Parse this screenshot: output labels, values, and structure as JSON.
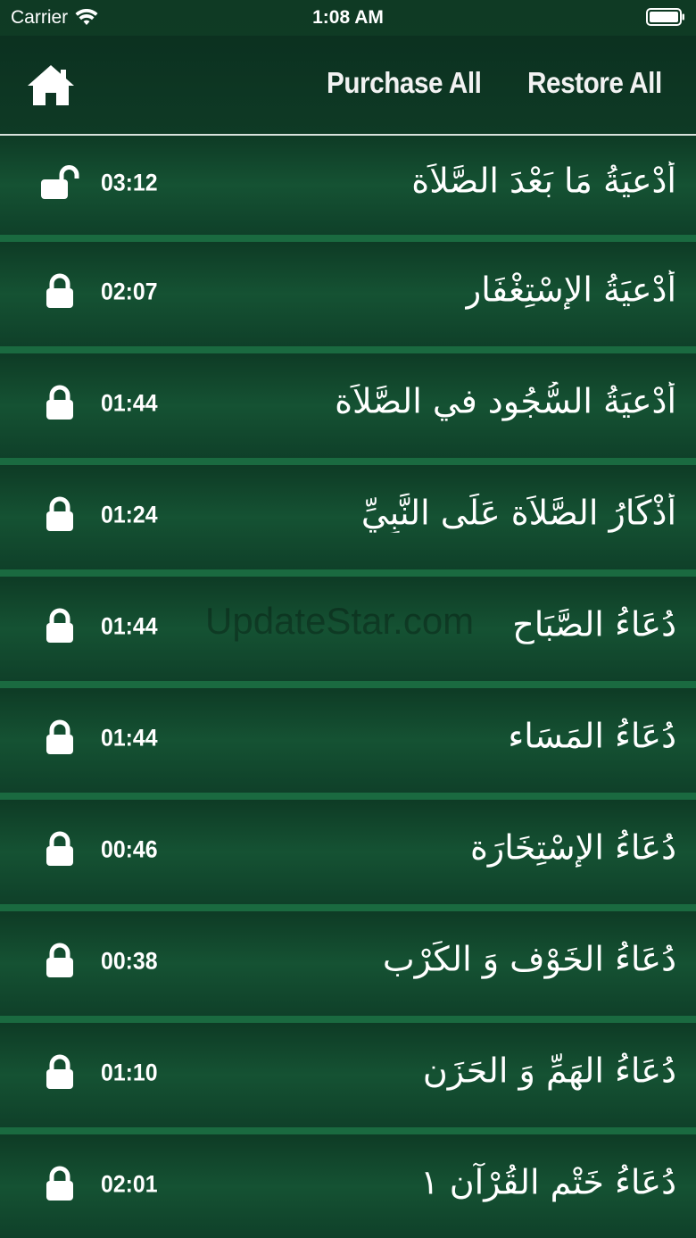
{
  "status_bar": {
    "carrier": "Carrier",
    "time": "1:08 AM",
    "wifi_icon": "wifi-icon",
    "battery_icon": "battery-icon"
  },
  "nav": {
    "home_icon": "home-icon",
    "purchase_label": "Purchase All",
    "restore_label": "Restore All"
  },
  "watermark": "UpdateStar.com",
  "items": [
    {
      "title": "أَدْعيَةُ مَا بَعْدَ الصَّلاَة",
      "duration": "03:12",
      "locked": false
    },
    {
      "title": "أَدْعيَةُ الإسْتِغْفَار",
      "duration": "02:07",
      "locked": true
    },
    {
      "title": "أَدْعيَةُ السُّجُود في الصَّلاَة",
      "duration": "01:44",
      "locked": true
    },
    {
      "title": "أَذْكَارُ الصَّلاَة عَلَى النَّبِيِّ",
      "duration": "01:24",
      "locked": true
    },
    {
      "title": "دُعَاءُ الصَّبَاح",
      "duration": "01:44",
      "locked": true
    },
    {
      "title": "دُعَاءُ المَسَاء",
      "duration": "01:44",
      "locked": true
    },
    {
      "title": "دُعَاءُ الإسْتِخَارَة",
      "duration": "00:46",
      "locked": true
    },
    {
      "title": "دُعَاءُ الخَوْف وَ الكَرْب",
      "duration": "00:38",
      "locked": true
    },
    {
      "title": "دُعَاءُ الهَمِّ وَ الحَزَن",
      "duration": "01:10",
      "locked": true
    },
    {
      "title": "دُعَاءُ خَتْمِ القُرْآن ١",
      "duration": "02:01",
      "locked": true
    }
  ],
  "colors": {
    "background": "#134a2e",
    "separator": "#1a6a40",
    "text": "#ffffff"
  }
}
